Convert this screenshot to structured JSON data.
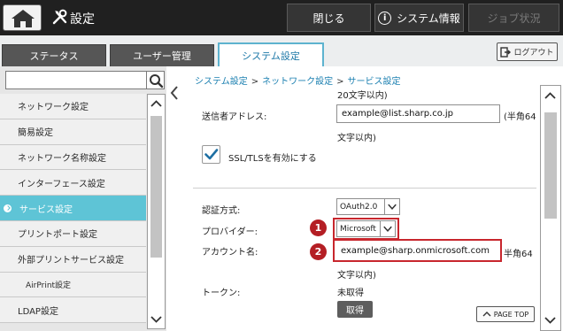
{
  "header": {
    "title": "設定",
    "close_label": "閉じる",
    "system_info_label": "システム情報",
    "job_status_label": "ジョブ状況"
  },
  "tabs": [
    "ステータス",
    "ユーザー管理",
    "システム設定"
  ],
  "logout_label": "ログアウト",
  "sidebar": {
    "items": [
      {
        "label": "ネットワーク設定"
      },
      {
        "label": "簡易設定"
      },
      {
        "label": "ネットワーク名称設定"
      },
      {
        "label": "インターフェース設定"
      },
      {
        "label": "サービス設定"
      },
      {
        "label": "プリントポート設定"
      },
      {
        "label": "外部プリントサービス設定"
      },
      {
        "label": "AirPrint設定"
      },
      {
        "label": "LDAP設定"
      }
    ]
  },
  "breadcrumb": [
    "システム設定",
    "ネットワーク設定",
    "サービス設定"
  ],
  "form": {
    "top_note": "20文字以内)",
    "sender_label": "送信者アドレス:",
    "sender_value": "example@list.sharp.co.jp",
    "sender_hint_a": "(半角64",
    "sender_hint_b": "文字以内)",
    "ssl_label": "SSL/TLSを有効にする",
    "auth_label": "認証方式:",
    "auth_value": "OAuth2.0",
    "provider_label": "プロバイダー:",
    "provider_value": "Microsoft",
    "account_label": "アカウント名:",
    "account_value": "example@sharp.onmicrosoft.com",
    "account_hint_a": "半角64",
    "account_hint_b": "文字以内)",
    "token_label": "トークン:",
    "token_value": "未取得",
    "acquire_label": "取得",
    "page_top_label": "PAGE TOP"
  },
  "callouts": [
    "1",
    "2"
  ],
  "colors": {
    "accent": "#5ec4d6",
    "link": "#1a7fb0",
    "callout": "#b41e24",
    "header_bg": "#202020"
  }
}
